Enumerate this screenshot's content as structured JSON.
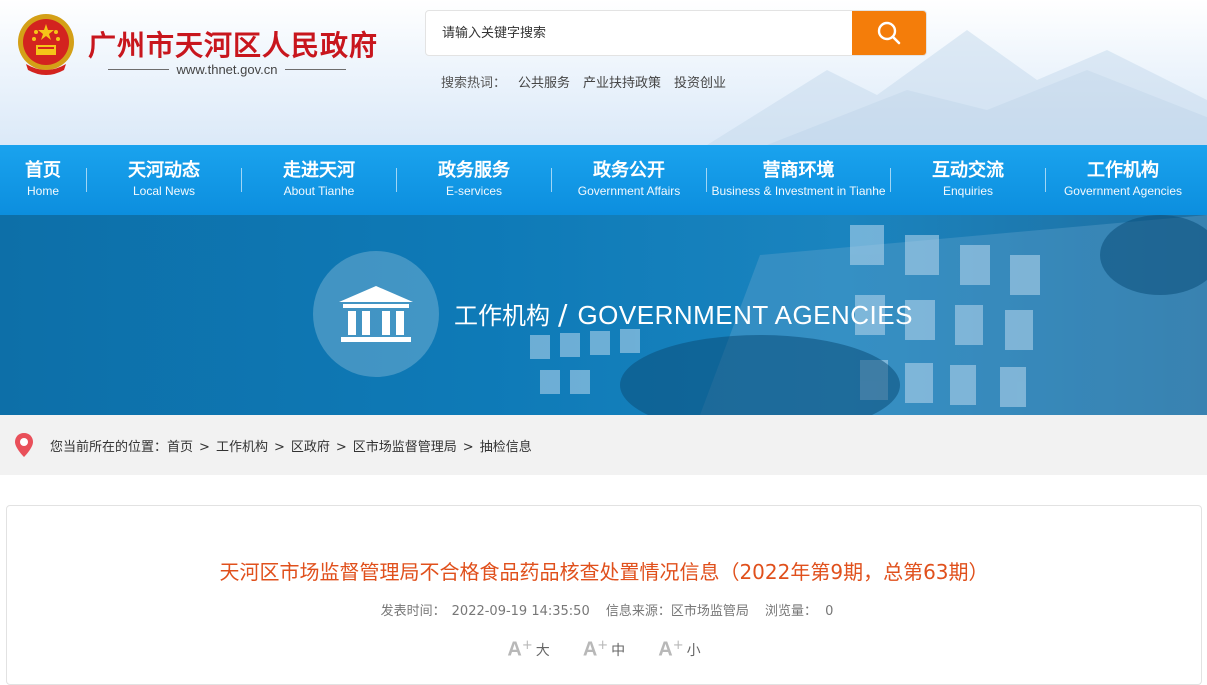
{
  "header": {
    "site_title": "广州市天河区人民政府",
    "site_url": "www.thnet.gov.cn",
    "search": {
      "placeholder": "请输入关键字搜索"
    },
    "hot_words": {
      "label": "搜索热词：",
      "items": [
        "公共服务",
        "产业扶持政策",
        "投资创业"
      ]
    }
  },
  "nav": {
    "items": [
      {
        "zh": "首页",
        "en": "Home"
      },
      {
        "zh": "天河动态",
        "en": "Local News"
      },
      {
        "zh": "走进天河",
        "en": "About Tianhe"
      },
      {
        "zh": "政务服务",
        "en": "E-services"
      },
      {
        "zh": "政务公开",
        "en": "Government Affairs"
      },
      {
        "zh": "营商环境",
        "en": "Business & Investment in Tianhe"
      },
      {
        "zh": "互动交流",
        "en": "Enquiries"
      },
      {
        "zh": "工作机构",
        "en": "Government Agencies"
      }
    ]
  },
  "banner": {
    "title_zh": "工作机构",
    "slash": "/",
    "title_en": "GOVERNMENT AGENCIES"
  },
  "breadcrumb": {
    "label": "您当前所在的位置：",
    "items": [
      "首页",
      "工作机构",
      "区政府",
      "区市场监督管理局",
      "抽检信息"
    ],
    "separator": ">"
  },
  "article": {
    "title": "天河区市场监督管理局不合格食品药品核查处置情况信息（2022年第9期，总第63期）",
    "publish_label": "发表时间：",
    "publish_time": "2022-09-19 14:35:50",
    "source_label": "信息来源：",
    "source": "区市场监管局",
    "views_label": "浏览量：",
    "views": "0",
    "font_sizes": [
      {
        "glyph": "A",
        "plus": "+",
        "label": "大"
      },
      {
        "glyph": "A",
        "plus": "+",
        "label": "中"
      },
      {
        "glyph": "A",
        "plus": "+",
        "label": "小"
      }
    ]
  },
  "colors": {
    "brand_red": "#c8161d",
    "nav_blue": "#1aa3ee",
    "search_orange": "#f47d0a",
    "title_orange": "#e0501c"
  }
}
